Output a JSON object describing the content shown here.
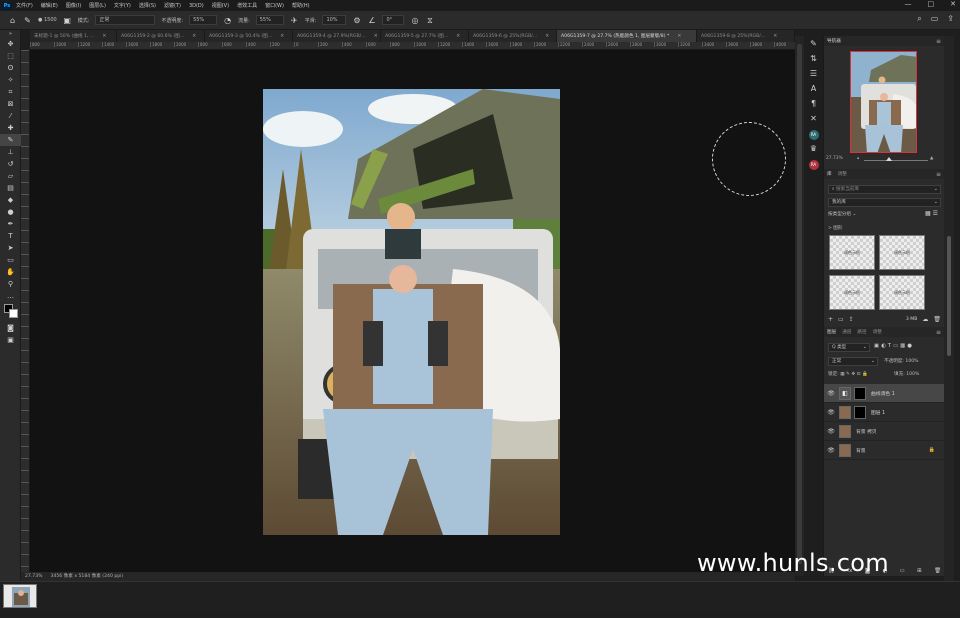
{
  "menubar": {
    "app_logo": "Ps",
    "items": [
      "文件(F)",
      "编辑(E)",
      "图像(I)",
      "图层(L)",
      "文字(Y)",
      "选择(S)",
      "滤镜(T)",
      "3D(D)",
      "视图(V)",
      "增效工具",
      "窗口(W)",
      "帮助(H)"
    ],
    "window_controls": [
      "—",
      "□",
      "✕"
    ]
  },
  "options": {
    "brush_size": "1500",
    "mode_label": "模式:",
    "mode_value": "正常",
    "opacity_label": "不透明度:",
    "opacity_value": "55%",
    "flow_label": "流量:",
    "flow_value": "55%",
    "smooth_label": "平滑:",
    "smooth_value": "10%",
    "angle_value": "0°"
  },
  "tabs": [
    {
      "label": "未标题-1 @ 50% (曲线 1, ...",
      "active": false
    },
    {
      "label": "A06G1359-2 @ 60.6% (图...",
      "active": false
    },
    {
      "label": "A06G1359-3 @ 50.4% (图...",
      "active": false
    },
    {
      "label": "A06G1359-4 @ 27.9%(RGB/...",
      "active": false
    },
    {
      "label": "A06G1359-5 @ 27.7% (图...",
      "active": false
    },
    {
      "label": "A06G1359-6 @ 25%(RGB/...",
      "active": false
    },
    {
      "label": "A06G1359-7 @ 27.7% (热能颜色 1, 图层蒙版/8) *",
      "active": true
    },
    {
      "label": "A06G1359-8 @ 25%(RGB/...",
      "active": false
    }
  ],
  "ruler_ticks": [
    "800",
    "1000",
    "1200",
    "1400",
    "1600",
    "1800",
    "2000",
    "800",
    "600",
    "400",
    "200",
    "0",
    "200",
    "400",
    "600",
    "800",
    "1000",
    "1200",
    "1400",
    "1600",
    "1800",
    "2000",
    "2200",
    "2400",
    "2600",
    "2800",
    "3000",
    "3200",
    "3400",
    "3600",
    "3800",
    "4000"
  ],
  "status": {
    "zoom": "27.73%",
    "doc_info": "3456 像素 x 5184 像素 (240 ppi)"
  },
  "panels": {
    "navigator_title": "导航器",
    "nav_zoom": "27.73%",
    "library_tabs": [
      "库",
      "调整"
    ],
    "library_search_placeholder": "搜索当前库",
    "library_dropdown": "我的库",
    "sort_label": "按类型分组",
    "library_section": "> 图形",
    "library_tiles": [
      "调色示例",
      "调色示例",
      "调色示例",
      "调色示例"
    ],
    "library_size": "3 MB",
    "layers_tabs": [
      "图层",
      "通道",
      "路径",
      "调整"
    ],
    "filter_label": "Q 类型",
    "blend_mode": "正常",
    "opacity_label": "不透明度:",
    "opacity_value": "100%",
    "lock_label": "锁定:",
    "fill_label": "填充:",
    "fill_value": "100%",
    "layers": [
      {
        "name": "曲线调色 1",
        "type": "adjustment",
        "selected": true
      },
      {
        "name": "图层 1",
        "type": "mask",
        "selected": false
      },
      {
        "name": "背景 拷贝",
        "type": "photo",
        "selected": false
      },
      {
        "name": "背景",
        "type": "photo-locked",
        "selected": false
      }
    ]
  },
  "right_icons": [
    "RA",
    "RA"
  ],
  "watermark": "www.hunls.com"
}
